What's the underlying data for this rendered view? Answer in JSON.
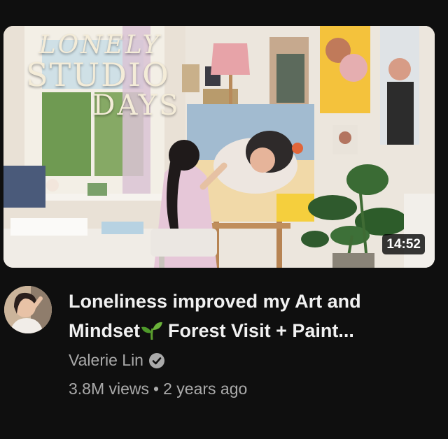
{
  "thumbnail": {
    "overlay_title": [
      "LONELY",
      "STUDIO",
      "DAYS"
    ],
    "duration": "14:52"
  },
  "video": {
    "title_line1": "Loneliness improved my Art and",
    "title_line2_before_icon": "Mindset",
    "title_line2_after_icon": "Forest Visit + Paint...",
    "title_icon": "sprout-emoji-icon"
  },
  "channel": {
    "name": "Valerie Lin",
    "verified_icon": "verified-check-icon"
  },
  "stats": {
    "views": "3.8M views",
    "separator": "•",
    "age": "2 years ago"
  },
  "colors": {
    "background": "#0f0f0f",
    "title_text": "#f1f1f1",
    "secondary_text": "#aaaaaa",
    "badge_bg": "#000000"
  }
}
